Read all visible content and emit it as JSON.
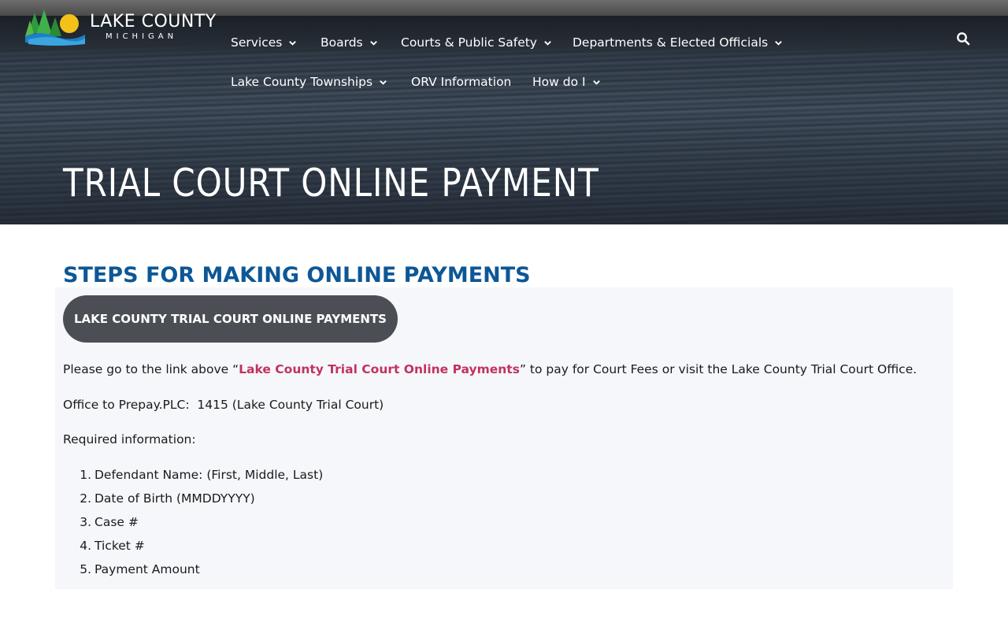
{
  "site": {
    "logo_title": "LAKE COUNTY",
    "logo_subtitle": "MICHIGAN"
  },
  "nav": {
    "items": [
      {
        "label": "Services",
        "has_dropdown": true
      },
      {
        "label": "Boards",
        "has_dropdown": true
      },
      {
        "label": "Courts & Public Safety",
        "has_dropdown": true
      },
      {
        "label": "Departments & Elected Officials",
        "has_dropdown": true
      },
      {
        "label": "Lake County Townships",
        "has_dropdown": true
      },
      {
        "label": "ORV Information",
        "has_dropdown": false
      },
      {
        "label": "How do I",
        "has_dropdown": true
      }
    ],
    "search_icon": "search-icon"
  },
  "hero": {
    "title": "TRIAL COURT ONLINE PAYMENT"
  },
  "content": {
    "heading": "STEPS FOR MAKING ONLINE PAYMENTS",
    "button_label": "LAKE COUNTY TRIAL COURT ONLINE PAYMENTS",
    "intro_before": "Please go to the link above “",
    "intro_link": "Lake County Trial Court Online Payments",
    "intro_after": "” to pay for Court Fees or visit the Lake County Trial Court Office.",
    "office_line": "Office to Prepay.PLC:  1415 (Lake County Trial Court)",
    "required_label": "Required information:",
    "required_items": [
      {
        "num": "1.",
        "text": "Defendant Name: (First, Middle, Last)"
      },
      {
        "num": "2.",
        "text": "Date of Birth (MMDDYYYY)"
      },
      {
        "num": "3.",
        "text": "Case #"
      },
      {
        "num": "4.",
        "text": "Ticket #"
      },
      {
        "num": "5.",
        "text": "Payment Amount"
      }
    ]
  },
  "colors": {
    "heading_blue": "#0d5796",
    "link_pink": "#c2325f",
    "button_gray": "#4b4e55",
    "panel_bg": "#f5f7fb"
  }
}
